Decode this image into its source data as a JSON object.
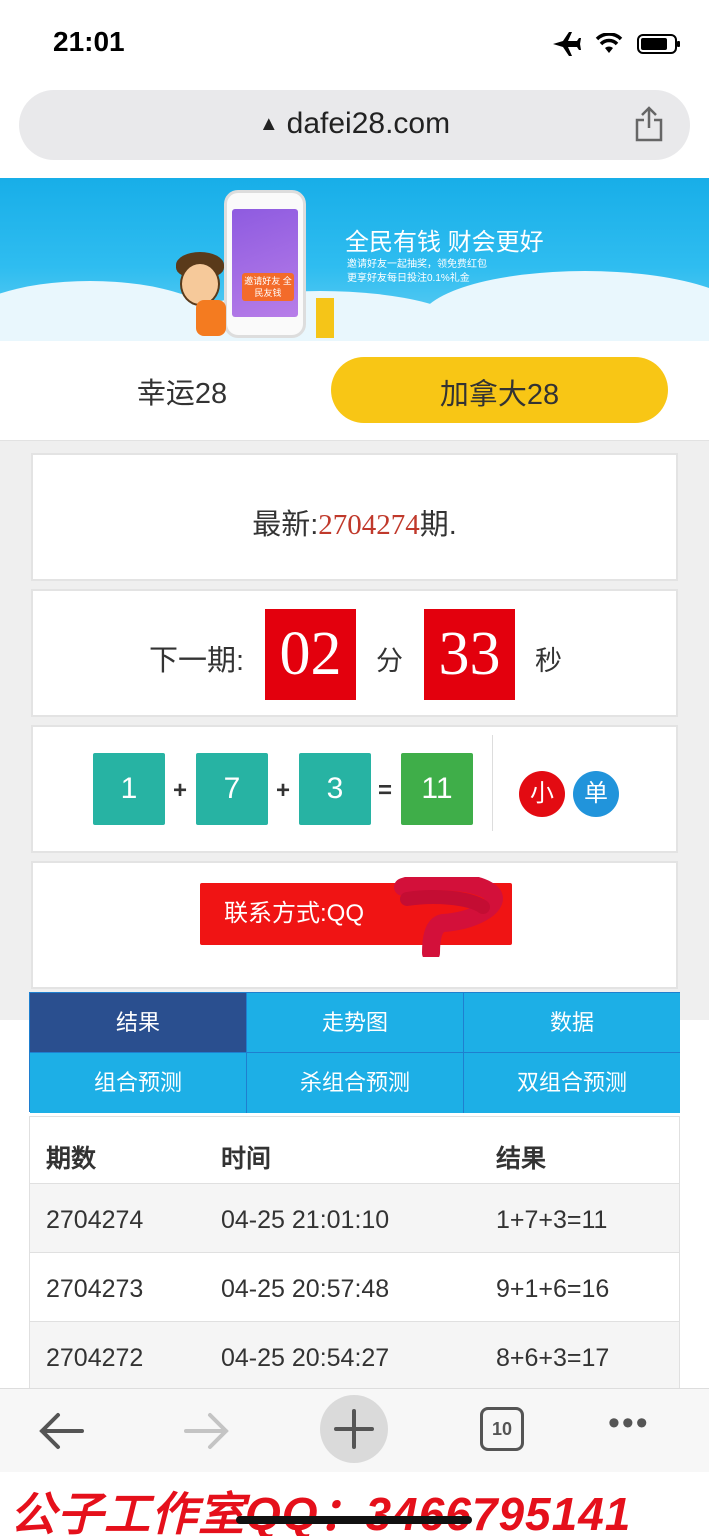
{
  "status_bar": {
    "time": "21:01"
  },
  "browser": {
    "url": "dafei28.com"
  },
  "banner": {
    "title": "全民有钱 财会更好",
    "subtitle_line1": "邀请好友一起抽奖，领免费红包",
    "subtitle_line2": "更享好友每日投注0.1%礼金",
    "phone_text": "邀请好友 全民友钱"
  },
  "lottery_tabs": [
    {
      "label": "幸运28",
      "active": false
    },
    {
      "label": "加拿大28",
      "active": true
    }
  ],
  "latest": {
    "prefix": "最新:",
    "issue": "2704274",
    "suffix": "期."
  },
  "next_draw": {
    "label": "下一期:",
    "minutes": "02",
    "minutes_unit": "分",
    "seconds": "33",
    "seconds_unit": "秒"
  },
  "result": {
    "balls": [
      "1",
      "7",
      "3"
    ],
    "plus": "+",
    "equals": "=",
    "sum": "11",
    "size_badge": "小",
    "parity_badge": "单",
    "colors": {
      "ball": "#27b3a3",
      "sum": "#3fae49",
      "small": "#e30b12",
      "odd": "#2194db"
    }
  },
  "contact": {
    "label": "联系方式:QQ"
  },
  "nav": [
    {
      "label": "结果",
      "active": true
    },
    {
      "label": "走势图",
      "active": false
    },
    {
      "label": "数据",
      "active": false
    },
    {
      "label": "组合预测",
      "active": false
    },
    {
      "label": "杀组合预测",
      "active": false
    },
    {
      "label": "双组合预测",
      "active": false
    }
  ],
  "table": {
    "headers": [
      "期数",
      "时间",
      "结果"
    ],
    "rows": [
      [
        "2704274",
        "04-25 21:01:10",
        "1+7+3=11"
      ],
      [
        "2704273",
        "04-25 20:57:48",
        "9+1+6=16"
      ],
      [
        "2704272",
        "04-25 20:54:27",
        "8+6+3=17"
      ]
    ]
  },
  "toolbar": {
    "tab_count": "10"
  },
  "watermark": "公子工作室QQ：3466795141",
  "icons": [
    "airplane-icon",
    "wifi-icon",
    "battery-icon",
    "lock-icon",
    "share-icon",
    "back-arrow-icon",
    "forward-arrow-icon",
    "plus-icon",
    "tabs-icon",
    "more-icon"
  ]
}
